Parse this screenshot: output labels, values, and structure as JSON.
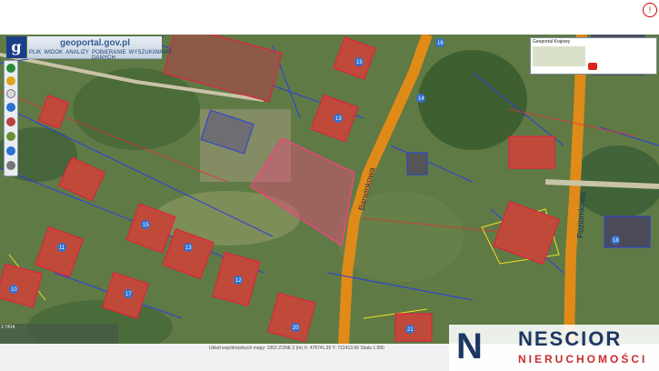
{
  "header": {
    "logo_letter": "g",
    "brand": "geoportal.gov.pl",
    "menu": [
      "PLIK",
      "WIDOK",
      "ANALIZY",
      "POBIERANIE DANYCH",
      "WYSZUKIWANIE"
    ]
  },
  "toolbar": {
    "buttons": [
      "globe-icon",
      "plus-icon",
      "minus-icon",
      "home-icon",
      "layers-icon",
      "ruler-icon",
      "info-icon",
      "print-icon"
    ]
  },
  "map": {
    "street_labels": [
      "Barwinkowa",
      "Poziomkowa"
    ],
    "parcel_numbers": [
      "16",
      "15",
      "14",
      "18",
      "11",
      "10",
      "13",
      "12",
      "17",
      "20",
      "21"
    ]
  },
  "minimap": {
    "title": "Geoportal Krajowy"
  },
  "scale": {
    "label": "1:7414"
  },
  "status": {
    "text": "Układ współrzędnych mapy: 1963 ZONE 2 (m)   X: 478741.35  Y: 722413.66   Skala 1:990"
  },
  "watermark": {
    "logo_letter": "N",
    "title": "NESCIOR",
    "subtitle": "NIERUCHOMOŚCI"
  },
  "colors": {
    "plot_highlight": "#e8487a",
    "road": "#e08a18",
    "building_outline": "#e0233b",
    "boundary_blue": "#2a3fe0",
    "boundary_yellow": "#f0e020",
    "brand_blue": "#1b3e88",
    "watermark_red": "#c92d2d"
  }
}
